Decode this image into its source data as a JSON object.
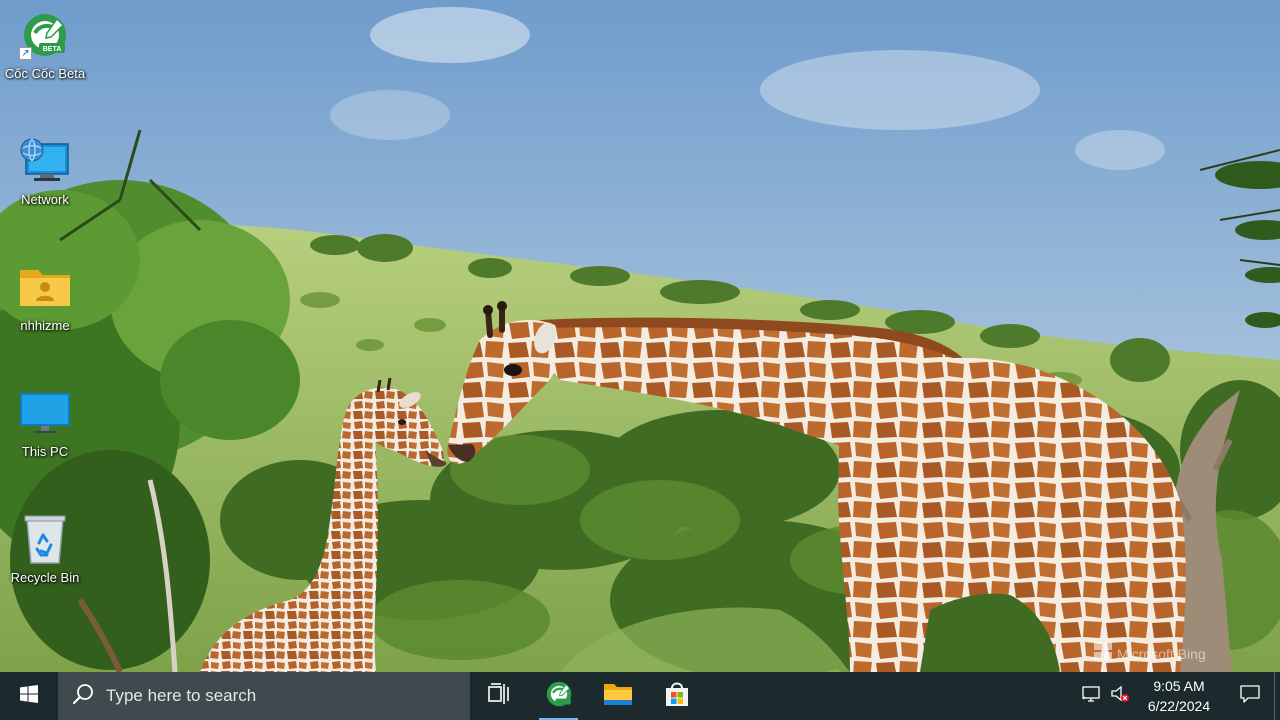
{
  "desktop": {
    "icons": [
      {
        "label": "Cốc Cốc Beta",
        "icon": "coccoc-beta-icon"
      },
      {
        "label": "Network",
        "icon": "network-icon"
      },
      {
        "label": "nhhizme",
        "icon": "user-folder-icon"
      },
      {
        "label": "This PC",
        "icon": "this-pc-icon"
      },
      {
        "label": "Recycle Bin",
        "icon": "recycle-bin-icon"
      }
    ],
    "beta_badge": "BETA"
  },
  "watermark": {
    "label": "Microsoft Bing",
    "icon": "bing-logo-icon"
  },
  "taskbar": {
    "start": {
      "icon": "windows-logo-icon"
    },
    "search": {
      "placeholder": "Type here to search",
      "icon": "search-icon"
    },
    "pinned": [
      {
        "name": "Task View",
        "icon": "task-view-icon"
      },
      {
        "name": "Cốc Cốc Beta",
        "icon": "coccoc-beta-icon"
      },
      {
        "name": "File Explorer",
        "icon": "folder-icon"
      },
      {
        "name": "Microsoft Store",
        "icon": "store-icon"
      }
    ],
    "tray": {
      "network_icon": "network-disconnected-icon",
      "volume_icon": "volume-muted-icon",
      "time": "9:05 AM",
      "date": "6/22/2024",
      "notifications_icon": "action-center-icon"
    }
  },
  "colors": {
    "taskbar_bg": "#1c2a2e",
    "search_bg": "#3f4a4e",
    "accent": "#76b9ed",
    "sky": "#8fb3d6",
    "grass": "#9cc06a",
    "giraffe": "#c0692a"
  }
}
